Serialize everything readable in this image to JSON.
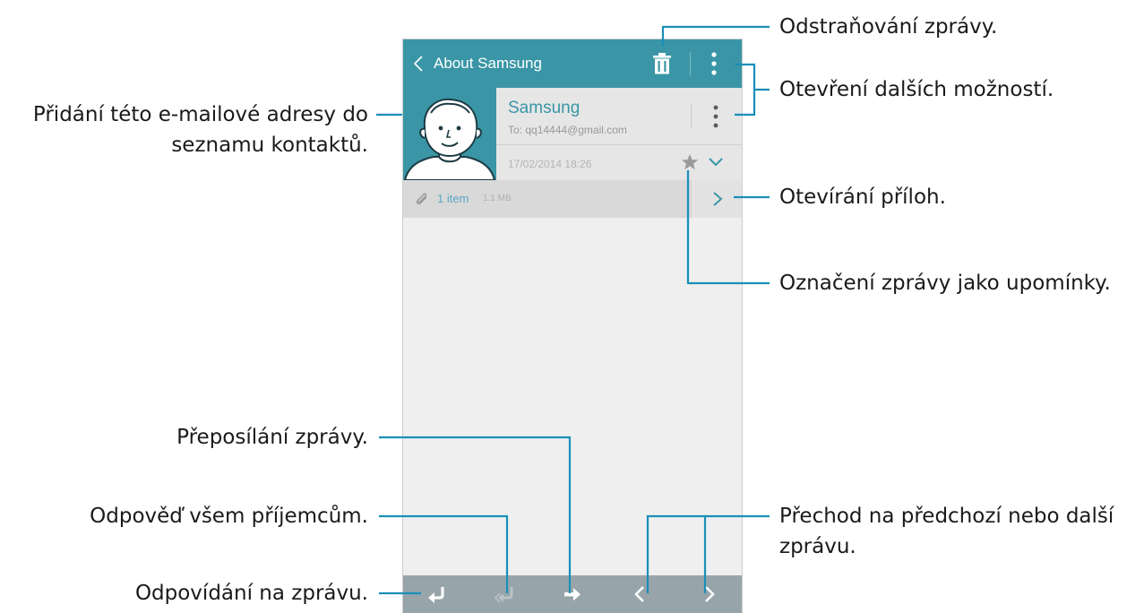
{
  "app": {
    "title": "About Samsung",
    "accent_color": "#3a96a6",
    "bottom_bar_color": "#97a4aa",
    "leader_line_color": "#1a8fb8"
  },
  "toolbar": {
    "back_icon": "chevron-left-icon",
    "delete_icon": "trash-icon",
    "more_icon": "more-vertical-icon"
  },
  "message": {
    "sender": "Samsung",
    "recipient": "To: qq14444@gmail.com",
    "date": "17/02/2014  18:26",
    "avatar_icon": "contact-avatar-icon",
    "header_more_icon": "more-vertical-icon",
    "favorite_icon": "star-icon",
    "expand_icon": "chevron-down-icon"
  },
  "attachment": {
    "icon": "paperclip-icon",
    "count_label": "1 item",
    "size": "1.1 MB",
    "open_icon": "chevron-right-icon"
  },
  "bottom_bar": {
    "items": [
      {
        "icon": "reply-icon"
      },
      {
        "icon": "reply-all-icon"
      },
      {
        "icon": "forward-icon"
      },
      {
        "icon": "previous-icon"
      },
      {
        "icon": "next-icon"
      }
    ]
  },
  "callouts": {
    "delete": "Odstraňování zprávy.",
    "more_options": "Otevření dalších možností.",
    "add_contact_line1": "Přidání této e-mailové adresy do",
    "add_contact_line2": "seznamu kontaktů.",
    "open_attachments": "Otevírání příloh.",
    "mark_reminder": "Označení zprávy jako upomínky.",
    "forward": "Přeposílání zprávy.",
    "reply_all": "Odpověď všem příjemcům.",
    "reply": "Odpovídání na zprávu.",
    "prev_next_line1": "Přechod na předchozí nebo další",
    "prev_next_line2": "zprávu."
  }
}
